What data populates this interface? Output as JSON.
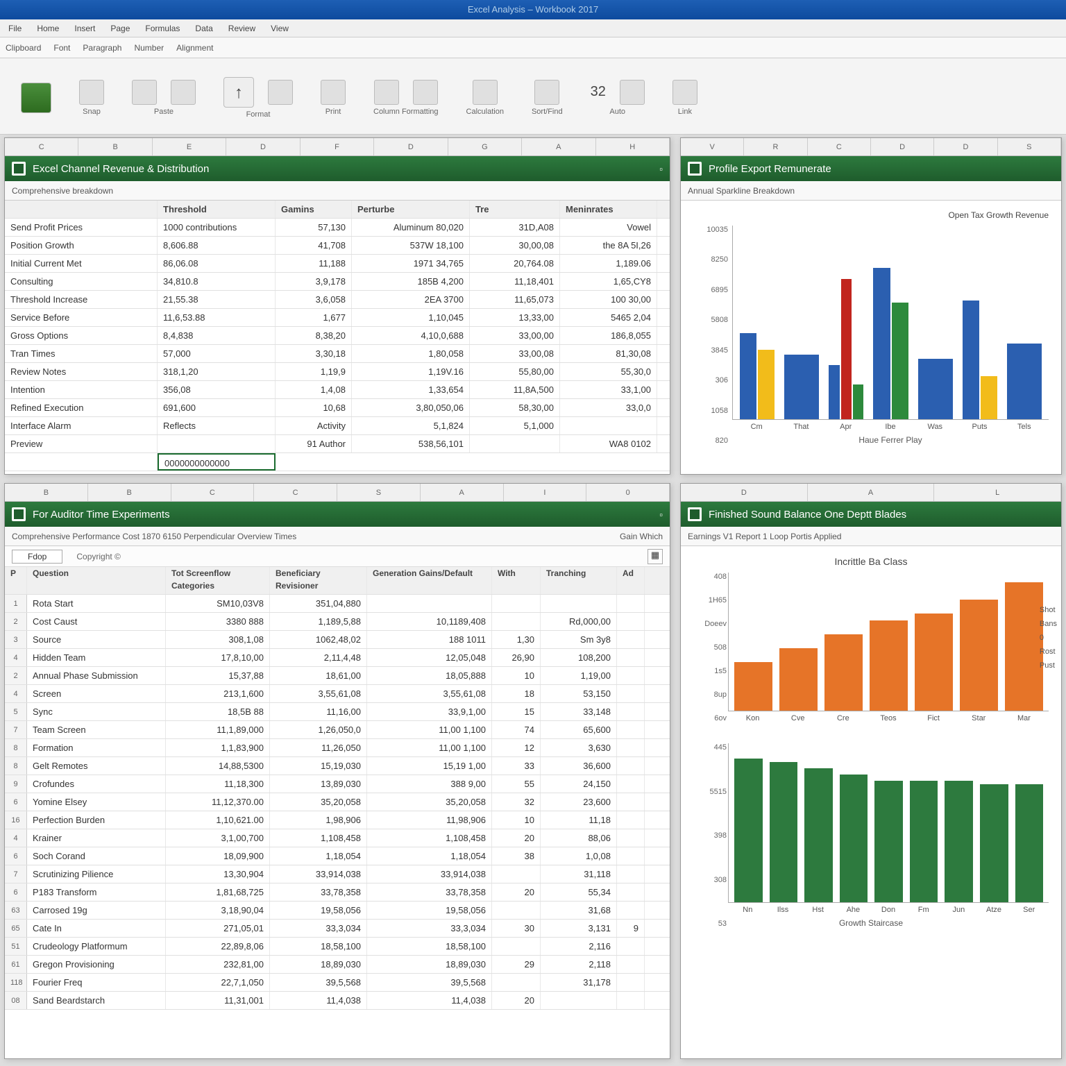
{
  "titlebar": "Excel Analysis – Workbook 2017",
  "menubar": [
    "File",
    "Home",
    "Insert",
    "Page",
    "Formulas",
    "Data",
    "Review",
    "View"
  ],
  "tabs": [
    "Clipboard",
    "Font",
    "Paragraph",
    "Number",
    "Alignment"
  ],
  "ribbon": {
    "groups": [
      {
        "label": "Snap"
      },
      {
        "label": "Paste"
      },
      {
        "label": "Format"
      },
      {
        "label": "Print"
      },
      {
        "label": "Column Formatting"
      },
      {
        "label": "Calculation"
      },
      {
        "label": "Sort/Find"
      },
      {
        "label": "Auto"
      },
      {
        "label": "Link"
      }
    ],
    "numbers": "32"
  },
  "panel1": {
    "title": "Excel Channel Revenue & Distribution",
    "subheader": "Comprehensive breakdown",
    "cols": [
      "",
      "Threshold",
      "Gamins",
      "Perturbe",
      "Tre",
      "Meninrates"
    ],
    "rows": [
      [
        "Send Profit Prices",
        "1000 contributions",
        "57,130",
        "Aluminum 80,020",
        "31D,A08",
        "Vowel"
      ],
      [
        "Position Growth",
        "8,606.88",
        "41,708",
        "537W 18,100",
        "30,00,08",
        "the 8A 5I,26"
      ],
      [
        "Initial Current Met",
        "86,06.08",
        "11,188",
        "1971 34,765",
        "20,764.08",
        "1,189.06"
      ],
      [
        "Consulting",
        "34,810.8",
        "3,9,178",
        "185B 4,200",
        "11,18,401",
        "1,65,CY8"
      ],
      [
        "Threshold Increase",
        "21,55.38",
        "3,6,058",
        "2EA 3700",
        "11,65,073",
        "100 30,00"
      ],
      [
        "Service Before",
        "11,6,53.88",
        "1,677",
        "1,10,045",
        "13,33,00",
        "5465 2,04"
      ],
      [
        "Gross Options",
        "8,4,838",
        "8,38,20",
        "4,10,0,688",
        "33,00,00",
        "186,8,055"
      ],
      [
        "Tran Times",
        "57,000",
        "3,30,18",
        "1,80,058",
        "33,00,08",
        "81,30,08"
      ],
      [
        "Review Notes",
        "318,1,20",
        "1,19,9",
        "1,19V.16",
        "55,80,00",
        "55,30,0"
      ],
      [
        "Intention",
        "356,08",
        "1,4,08",
        "1,33,654",
        "11,8A,500",
        "33,1,00"
      ],
      [
        "Refined Execution",
        "691,600",
        "10,68",
        "3,80,050,06",
        "58,30,00",
        "33,0,0"
      ],
      [
        "Interface Alarm",
        "Reflects",
        "Activity",
        "5,1,824",
        "5,1,000",
        ""
      ],
      [
        "Preview",
        "",
        "91 Author",
        "538,56,101",
        "",
        "WA8 0102"
      ]
    ],
    "selectedCell": "0000000000000"
  },
  "panel2": {
    "title": "Profile Export Remunerate",
    "subheader": "Annual Sparkline Breakdown",
    "legend": "Open Tax Growth Revenue"
  },
  "panel3": {
    "title": "For Auditor Time Experiments",
    "subheader": "Comprehensive Performance Cost 1870 6150 Perpendicular Overview Times",
    "extra": "Gain Which",
    "cols": [
      "P",
      "Question",
      "Tot Screenflow Categories",
      "Beneficiary Revisioner",
      "Generation Gains/Default",
      "With",
      "Tranching",
      "Ad"
    ],
    "rows": [
      [
        "1",
        "Rota Start",
        "SM10,03V8",
        "351,04,880",
        "",
        "",
        "",
        ""
      ],
      [
        "2",
        "Cost Caust",
        "3380 888",
        "1,189,5,88",
        "10,1189,408",
        "",
        "Rd,000,00",
        ""
      ],
      [
        "3",
        "Source",
        "308,1,08",
        "1062,48,02",
        "188 1011",
        "1,30",
        "Sm 3y8",
        ""
      ],
      [
        "4",
        "Hidden Team",
        "17,8,10,00",
        "2,11,4,48",
        "12,05,048",
        "26,90",
        "108,200",
        ""
      ],
      [
        "2",
        "Annual Phase Submission",
        "15,37,88",
        "18,61,00",
        "18,05,888",
        "10",
        "1,19,00",
        ""
      ],
      [
        "4",
        "Screen",
        "213,1,600",
        "3,55,61,08",
        "3,55,61,08",
        "18",
        "53,150",
        ""
      ],
      [
        "5",
        "Sync",
        "18,5B 88",
        "11,16,00",
        "33,9,1,00",
        "15",
        "33,148",
        ""
      ],
      [
        "7",
        "Team Screen",
        "11,1,89,000",
        "1,26,050,0",
        "11,00 1,100",
        "74",
        "65,600",
        ""
      ],
      [
        "8",
        "Formation",
        "1,1,83,900",
        "11,26,050",
        "11,00 1,100",
        "12",
        "3,630",
        ""
      ],
      [
        "8",
        "Gelt Remotes",
        "14,88,5300",
        "15,19,030",
        "15,19 1,00",
        "33",
        "36,600",
        ""
      ],
      [
        "9",
        "Crofundes",
        "11,18,300",
        "13,89,030",
        "388 9,00",
        "55",
        "24,150",
        ""
      ],
      [
        "6",
        "Yomine Elsey",
        "11,12,370.00",
        "35,20,058",
        "35,20,058",
        "32",
        "23,600",
        ""
      ],
      [
        "16",
        "Perfection Burden",
        "1,10,621.00",
        "1,98,906",
        "11,98,906",
        "10",
        "11,18",
        ""
      ],
      [
        "4",
        "Krainer",
        "3,1,00,700",
        "1,108,458",
        "1,108,458",
        "20",
        "88,06",
        ""
      ],
      [
        "6",
        "Soch Corand",
        "18,09,900",
        "1,18,054",
        "1,18,054",
        "38",
        "1,0,08",
        ""
      ],
      [
        "7",
        "Scrutinizing Pilience",
        "13,30,904",
        "33,914,038",
        "33,914,038",
        "",
        "31,118",
        ""
      ],
      [
        "6",
        "P183 Transform",
        "1,81,68,725",
        "33,78,358",
        "33,78,358",
        "20",
        "55,34",
        ""
      ],
      [
        "63",
        "Carrosed 19g",
        "3,18,90,04",
        "19,58,056",
        "19,58,056",
        "",
        "31,68",
        ""
      ],
      [
        "65",
        "Cate In",
        "271,05,01",
        "33,3,034",
        "33,3,034",
        "30",
        "3,131",
        "9"
      ],
      [
        "51",
        "Crudeology Platformum",
        "22,89,8,06",
        "18,58,100",
        "18,58,100",
        "",
        "2,116",
        ""
      ],
      [
        "61",
        "Gregon Provisioning",
        "232,81,00",
        "18,89,030",
        "18,89,030",
        "29",
        "2,118",
        ""
      ],
      [
        "118",
        "Fourier Freq",
        "22,7,1,050",
        "39,5,568",
        "39,5,568",
        "",
        "31,178",
        ""
      ],
      [
        "08",
        "Sand Beardstarch",
        "11,31,001",
        "11,4,038",
        "11,4,038",
        "20",
        "",
        ""
      ]
    ]
  },
  "panel4": {
    "title": "Finished Sound Balance One Deptt Blades",
    "subheader": "Earnings V1 Report 1 Loop Portis Applied",
    "chartTitle": "Incrittle Ba Class"
  },
  "chart_data": [
    {
      "type": "bar",
      "title": "Open Tax Growth Revenue",
      "categories": [
        "Cm",
        "That",
        "Apr",
        "Ibe",
        "Was",
        "Puts",
        "Tels"
      ],
      "series": [
        {
          "name": "Blue",
          "color": "#2b5fb0",
          "values": [
            4000,
            3000,
            2500,
            7000,
            2800,
            5500,
            3500
          ]
        },
        {
          "name": "Yellow",
          "color": "#f2bc1a",
          "values": [
            3200,
            0,
            0,
            0,
            0,
            2000,
            0
          ]
        },
        {
          "name": "Red",
          "color": "#c1251e",
          "values": [
            0,
            0,
            6500,
            0,
            0,
            0,
            0
          ]
        },
        {
          "name": "Green",
          "color": "#2d8a3c",
          "values": [
            0,
            0,
            1600,
            5400,
            0,
            0,
            0
          ]
        }
      ],
      "ylim": [
        0,
        9000
      ],
      "yticks": [
        "10035",
        "8250",
        "6895",
        "5808",
        "3845",
        "306",
        "1058",
        "820"
      ],
      "xlabel": "Haue Ferrer Play"
    },
    {
      "type": "bar",
      "title": "Incrittle Ba Class",
      "categories": [
        "Kon",
        "Cve",
        "Cre",
        "Teos",
        "Fict",
        "Star",
        "Mar"
      ],
      "values": [
        1400,
        1800,
        2200,
        2600,
        2800,
        3200,
        3700
      ],
      "color": "#e67428",
      "ylim": [
        0,
        4000
      ],
      "yticks": [
        "408",
        "1H65",
        "Doeev",
        "508",
        "1s5",
        "8up",
        "6ov"
      ],
      "legend": [
        "Shot",
        "Bans",
        "0",
        "Rost",
        "Pust"
      ]
    },
    {
      "type": "bar",
      "categories": [
        "Nn",
        "Ilss",
        "Hst",
        "Ahe",
        "Don",
        "Fm",
        "Jun",
        "Atze",
        "Ser"
      ],
      "values": [
        450,
        440,
        420,
        400,
        380,
        380,
        380,
        370,
        370
      ],
      "color": "#2d7a3e",
      "ylim": [
        0,
        500
      ],
      "yticks": [
        "445",
        "5515",
        "398",
        "308",
        "53"
      ],
      "xlabel": "Growth Staircase"
    }
  ]
}
